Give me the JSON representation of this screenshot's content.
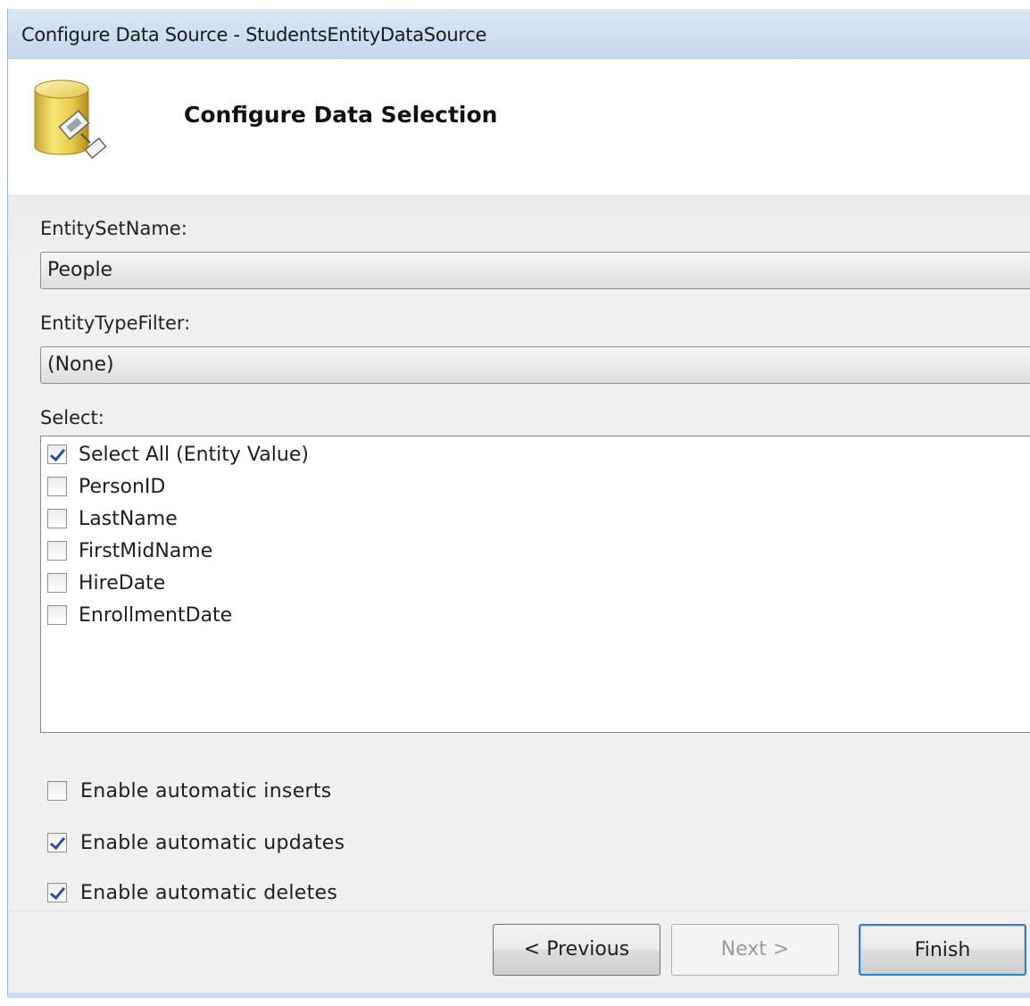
{
  "window": {
    "title": "Configure Data Source - StudentsEntityDataSource"
  },
  "header": {
    "title": "Configure Data Selection",
    "icon": "database-icon"
  },
  "entity_set": {
    "label": "EntitySetName:",
    "value": "People"
  },
  "entity_type_filter": {
    "label": "EntityTypeFilter:",
    "value": "(None)"
  },
  "select": {
    "label": "Select:",
    "items": [
      {
        "label": "Select All (Entity Value)",
        "checked": true
      },
      {
        "label": "PersonID",
        "checked": false
      },
      {
        "label": "LastName",
        "checked": false
      },
      {
        "label": "FirstMidName",
        "checked": false
      },
      {
        "label": "HireDate",
        "checked": false
      },
      {
        "label": "EnrollmentDate",
        "checked": false
      }
    ]
  },
  "options": [
    {
      "label": "Enable automatic inserts",
      "checked": false
    },
    {
      "label": "Enable automatic updates",
      "checked": true
    },
    {
      "label": "Enable automatic deletes",
      "checked": true
    }
  ],
  "buttons": {
    "previous": {
      "label": "< Previous",
      "enabled": true
    },
    "next": {
      "label": "Next >",
      "enabled": false
    },
    "finish": {
      "label": "Finish",
      "enabled": true
    }
  }
}
